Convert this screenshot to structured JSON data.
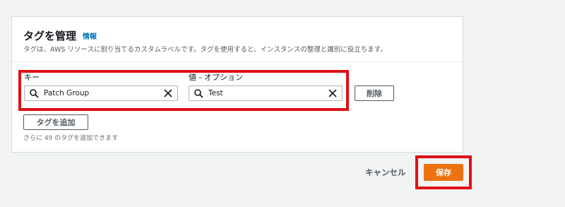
{
  "panel": {
    "title": "タグを管理",
    "info_link": "情報",
    "description": "タグは、AWS リソースに割り当てるカスタムラベルです。タグを使用すると、インスタンスの整理と識別に役立ちます。"
  },
  "tag_row": {
    "key_label": "キー",
    "value_label": "値 - オプション",
    "key_value": "Patch Group",
    "value_value": "Test",
    "remove_label": "削除"
  },
  "add_tag_label": "タグを追加",
  "remaining_hint": "さらに 49 のタグを追加できます",
  "footer": {
    "cancel_label": "キャンセル",
    "save_label": "保存"
  },
  "icons": {
    "search": "search-icon",
    "clear": "close-icon"
  },
  "colors": {
    "accent": "#ec7211",
    "link": "#0073bb",
    "highlight": "#e01017"
  }
}
